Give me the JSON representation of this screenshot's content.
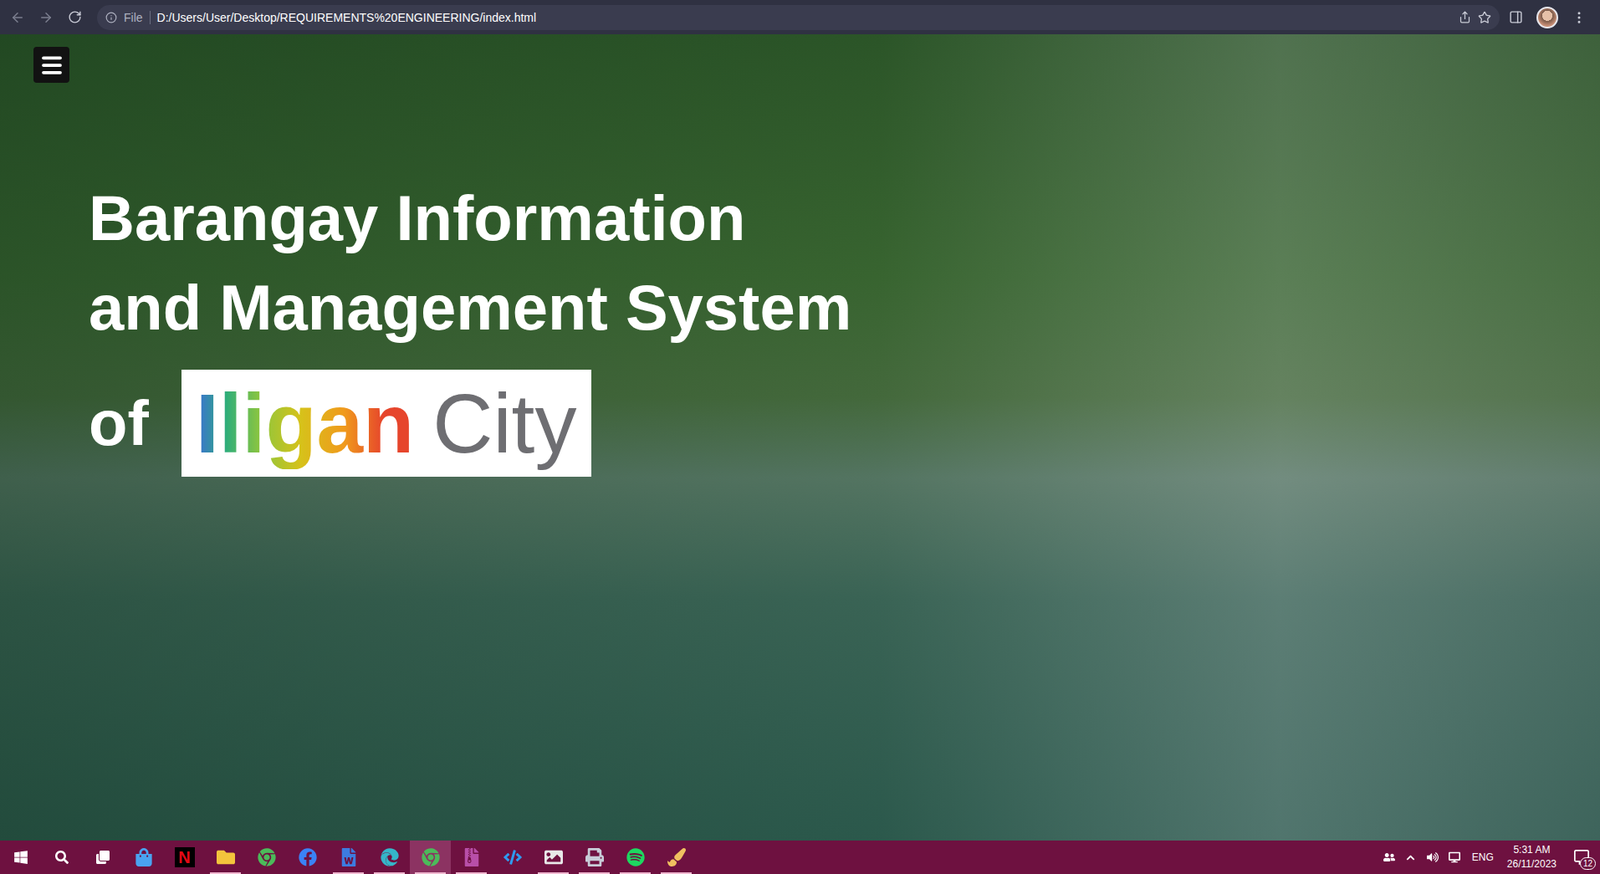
{
  "browser": {
    "file_label": "File",
    "url": "D:/Users/User/Desktop/REQUIREMENTS%20ENGINEERING/index.html"
  },
  "page": {
    "title_lines": [
      "Barangay Information",
      "and Management System"
    ],
    "of": "of",
    "logo": {
      "word": "Iligan",
      "city": "City"
    }
  },
  "taskbar": {
    "apps": [
      {
        "kind": "store",
        "label": "",
        "running": false,
        "selected": false
      },
      {
        "kind": "netflix",
        "label": "N",
        "running": false,
        "selected": false
      },
      {
        "kind": "explorer",
        "label": "",
        "running": true,
        "selected": false
      },
      {
        "kind": "chrome",
        "label": "",
        "running": false,
        "selected": false
      },
      {
        "kind": "facebook",
        "label": "",
        "running": false,
        "selected": false
      },
      {
        "kind": "word",
        "label": "",
        "running": true,
        "selected": false
      },
      {
        "kind": "edge",
        "label": "",
        "running": true,
        "selected": false
      },
      {
        "kind": "chrome",
        "label": "",
        "running": true,
        "selected": true
      },
      {
        "kind": "winrar",
        "label": "",
        "running": true,
        "selected": false
      },
      {
        "kind": "vscode",
        "label": "",
        "running": false,
        "selected": false
      },
      {
        "kind": "photos",
        "label": "",
        "running": true,
        "selected": false
      },
      {
        "kind": "printer",
        "label": "",
        "running": true,
        "selected": false
      },
      {
        "kind": "spotify",
        "label": "",
        "running": true,
        "selected": false
      },
      {
        "kind": "paint",
        "label": "",
        "running": true,
        "selected": false
      }
    ],
    "language": "ENG",
    "time": "5:31 AM",
    "date": "26/11/2023",
    "notifications": "12"
  }
}
